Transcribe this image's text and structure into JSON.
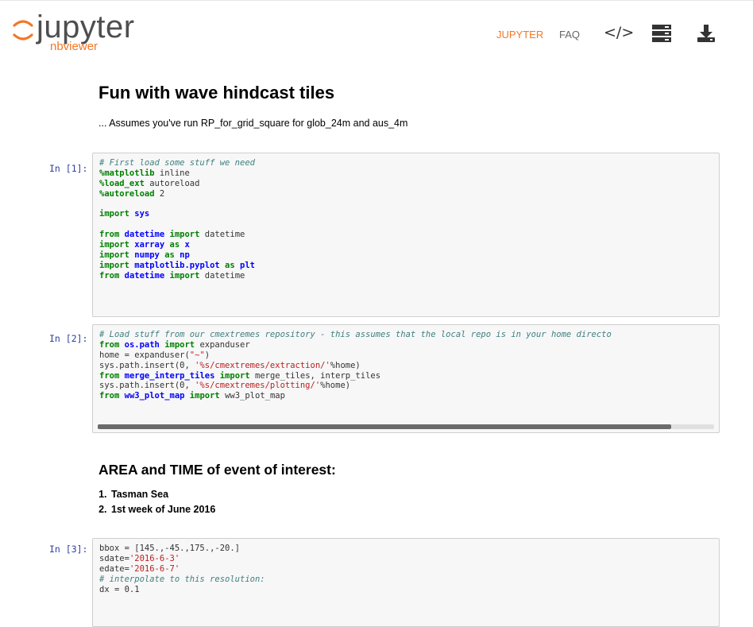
{
  "navbar": {
    "logo_text": "jupyter",
    "logo_sub": "nbviewer",
    "links": [
      {
        "label": "JUPYTER"
      },
      {
        "label": "FAQ"
      }
    ],
    "code_icon_glyph": "</>",
    "icons": [
      "code-icon",
      "stack-icon",
      "download-icon"
    ],
    "accent_color": "#f37726"
  },
  "notebook": {
    "title": "Fun with wave hindcast tiles",
    "subtitle": "... Assumes you've run RP_for_grid_square for glob_24m and aus_4m",
    "cells": [
      {
        "prompt": "In [1]:"
      },
      {
        "prompt": "In [2]:"
      },
      {
        "prompt": "In [3]:"
      }
    ],
    "section2": {
      "heading": "AREA and TIME of event of interest:",
      "items": [
        "Tasman Sea",
        "1st week of June 2016"
      ]
    }
  },
  "code": {
    "cell1": [
      {
        "t": "# First load some stuff we need"
      },
      {
        "k": "%matplotlib",
        "t": " inline"
      },
      {
        "k": "%load_ext",
        "t": " autoreload"
      },
      {
        "k": "%autoreload",
        "t": " 2"
      },
      {
        "t": ""
      },
      {
        "k": "import",
        "n": " sys"
      },
      {
        "t": ""
      },
      {
        "k": "from",
        "n": " datetime",
        "k2": " import",
        "t": " datetime"
      },
      {
        "k": "import",
        "n": " xarray",
        "k2": " as",
        "n2": " x"
      },
      {
        "k": "import",
        "n": " numpy",
        "k2": " as",
        "n2": " np"
      },
      {
        "k": "import",
        "n": " matplotlib.pyplot",
        "k2": " as",
        "n2": " plt"
      },
      {
        "k": "from",
        "n": " datetime",
        "k2": " import",
        "t": " datetime"
      }
    ],
    "cell2": [
      {
        "t": "# Load stuff from our cmextremes repository - this assumes that the local repo is in your home directo"
      },
      {
        "k": "from",
        "n": " os.path",
        "k2": " import",
        "t": " expanduser"
      },
      {
        "t": "home = expanduser(",
        "s": "\"~\"",
        "t2": ")"
      },
      {
        "t": "sys.path.insert(0, ",
        "s": "'%s/cmextremes/extraction/'",
        "t2": "%home)"
      },
      {
        "k": "from",
        "n": " merge_interp_tiles",
        "k2": " import",
        "t": " merge_tiles, interp_tiles"
      },
      {
        "t": "sys.path.insert(0, ",
        "s": "'%s/cmextremes/plotting/'",
        "t2": "%home)"
      },
      {
        "k": "from",
        "n": " ww3_plot_map",
        "k2": " import",
        "t": " ww3_plot_map"
      }
    ],
    "cell3": [
      {
        "t": "bbox = [145.,-45.,175.,-20.]"
      },
      {
        "t": "sdate=",
        "s": "'2016-6-3'"
      },
      {
        "t": "edate=",
        "s": "'2016-6-7'"
      },
      {
        "t": "# interpolate to this resolution:"
      },
      {
        "t": "dx = 0.1"
      }
    ]
  }
}
